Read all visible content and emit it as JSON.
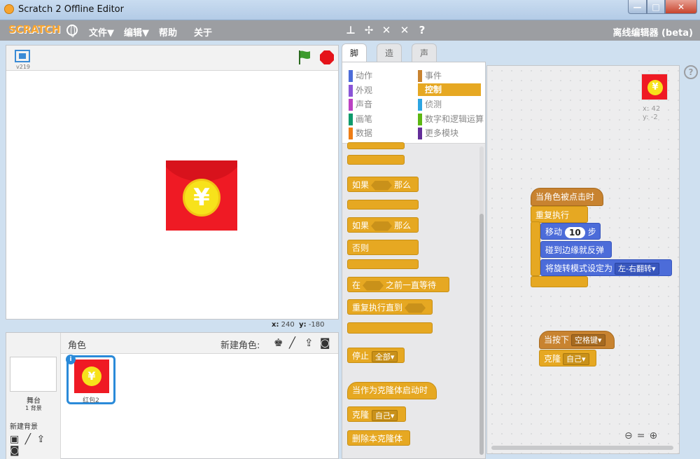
{
  "window": {
    "title": "Scratch 2 Offline Editor",
    "min": "—",
    "max": "□",
    "close": "✕"
  },
  "menubar": {
    "logo": "SCRATCH",
    "file": "文件▼",
    "edit": "编辑▼",
    "help": "帮助",
    "about": "关于",
    "editor_label": "离线编辑器 (beta)"
  },
  "stage": {
    "version": "v219",
    "x_label": "x:",
    "x_value": "240",
    "y_label": "y:",
    "y_value": "-180",
    "coin_symbol": "¥"
  },
  "sprites": {
    "title": "角色",
    "new_sprite": "新建角色:",
    "stage_name": "舞台",
    "stage_backdrops": "1 背景",
    "new_backdrop": "新建背景",
    "selected_sprite": "红包2"
  },
  "tabs": [
    "脚本",
    "造型",
    "声音"
  ],
  "categories": {
    "motion": "动作",
    "looks": "外观",
    "sound": "声音",
    "pen": "画笔",
    "data": "数据",
    "events": "事件",
    "control": "控制",
    "sensing": "侦测",
    "operators": "数字和逻辑运算",
    "more": "更多模块"
  },
  "colors": {
    "motion": "#4c6cd9",
    "looks": "#8a55d7",
    "sound": "#bb42c3",
    "pen": "#0e9a6c",
    "data": "#ee7d16",
    "events": "#c88330",
    "control": "#e6a822",
    "sensing": "#2ca5e2",
    "operators": "#5cb712",
    "more": "#632d99"
  },
  "palette_blocks": {
    "if_label": "如果",
    "then_label": "那么",
    "if2_label": "如果",
    "then2_label": "那么",
    "else_label": "否则",
    "wait_until_pre": "在",
    "wait_until_post": "之前一直等待",
    "repeat_until": "重复执行直到",
    "stop_label": "停止",
    "stop_option": "全部▾",
    "clone_start": "当作为克隆体启动时",
    "clone_label": "克隆",
    "clone_option": "自己▾",
    "delete_clone": "删除本克隆体"
  },
  "script_sprite": {
    "x": "x: 42",
    "y": "y: -2"
  },
  "script": {
    "when_clicked": "当角色被点击时",
    "forever": "重复执行",
    "move_pre": "移动",
    "move_steps": "10",
    "move_post": "步",
    "bounce": "碰到边缘就反弹",
    "rotation_style": "将旋转模式设定为",
    "rotation_option": "左-右翻转▾",
    "key_pressed": "当按下",
    "key_option": "空格键▾",
    "clone_label": "克隆",
    "clone_option": "自己▾"
  },
  "help_icon": "?"
}
